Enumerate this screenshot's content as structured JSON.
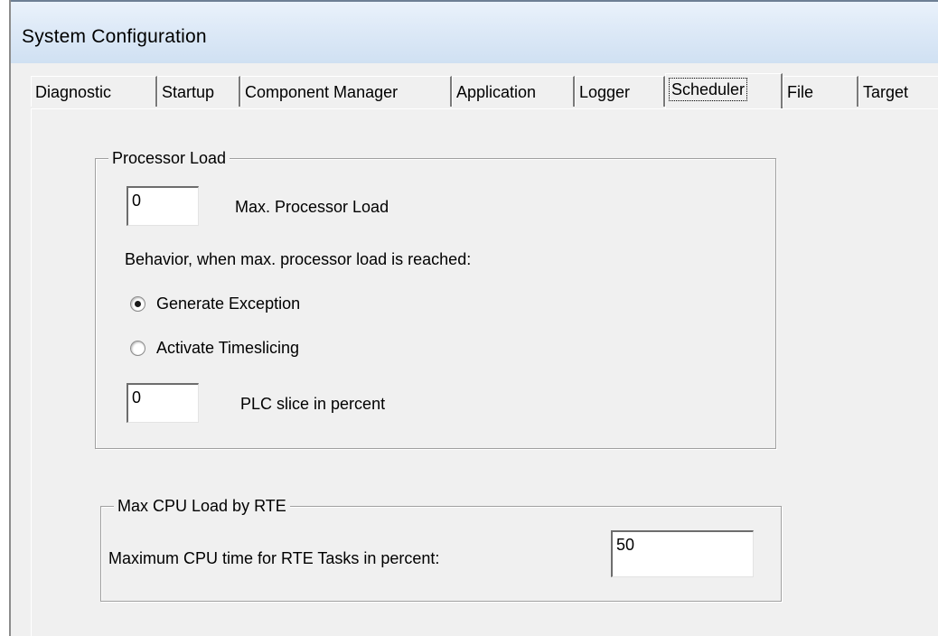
{
  "window": {
    "title": "System Configuration"
  },
  "tabs": [
    {
      "label": "Diagnostic",
      "active": false
    },
    {
      "label": "Startup",
      "active": false
    },
    {
      "label": "Component Manager",
      "active": false
    },
    {
      "label": "Application",
      "active": false
    },
    {
      "label": "Logger",
      "active": false
    },
    {
      "label": "Scheduler",
      "active": true
    },
    {
      "label": "File",
      "active": false
    },
    {
      "label": "Target",
      "active": false
    }
  ],
  "processor_load": {
    "group_label": "Processor Load",
    "max_load_value": "0",
    "max_load_label": "Max. Processor Load",
    "behavior_label": "Behavior, when max. processor load is reached:",
    "options": [
      {
        "label": "Generate Exception",
        "checked": true
      },
      {
        "label": "Activate Timeslicing",
        "checked": false
      }
    ],
    "plc_slice_value": "0",
    "plc_slice_label": "PLC slice in percent"
  },
  "rte_load": {
    "group_label": "Max CPU Load by RTE",
    "max_cpu_label": "Maximum CPU time for RTE Tasks in percent:",
    "max_cpu_value": "50"
  }
}
